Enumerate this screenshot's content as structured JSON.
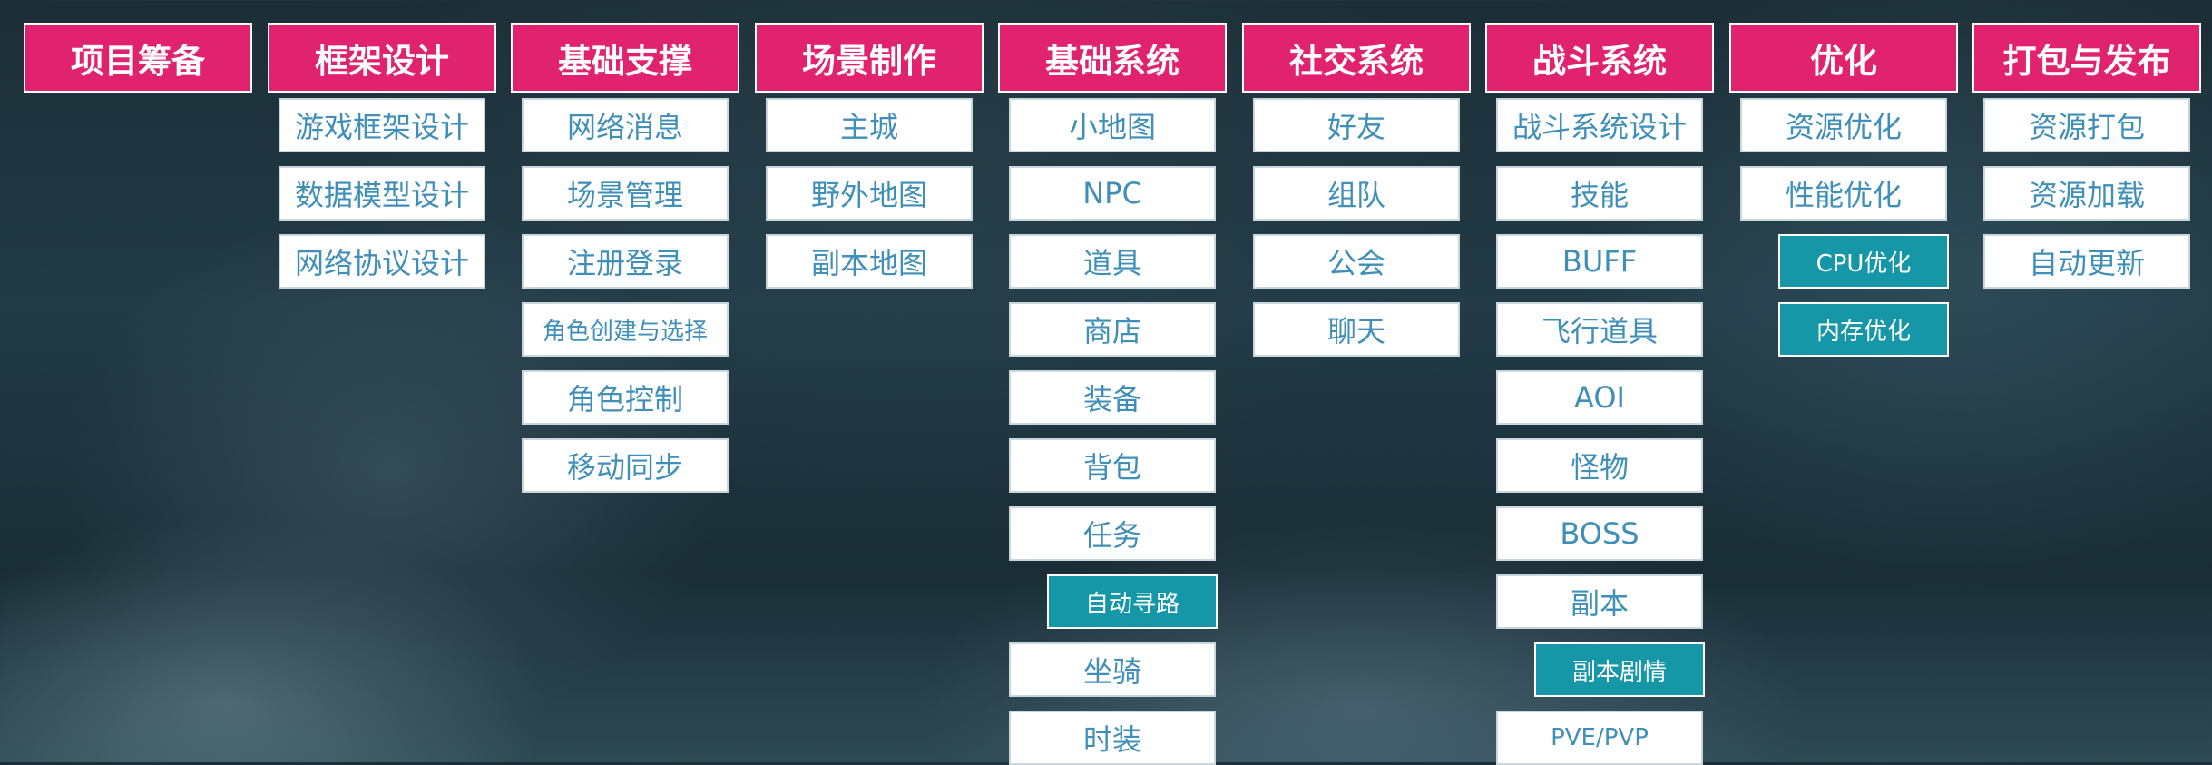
{
  "colors": {
    "header_bg": "#e0226f",
    "item_bg": "#ffffff",
    "item_text": "#3f8fb8",
    "sub_item_bg": "#1597a7"
  },
  "columns": [
    {
      "header": "项目筹备",
      "items": []
    },
    {
      "header": "框架设计",
      "items": [
        {
          "label": "游戏框架设计"
        },
        {
          "label": "数据模型设计"
        },
        {
          "label": "网络协议设计"
        }
      ]
    },
    {
      "header": "基础支撑",
      "items": [
        {
          "label": "网络消息"
        },
        {
          "label": "场景管理"
        },
        {
          "label": "注册登录"
        },
        {
          "label": "角色创建与选择"
        },
        {
          "label": "角色控制"
        },
        {
          "label": "移动同步"
        }
      ]
    },
    {
      "header": "场景制作",
      "items": [
        {
          "label": "主城"
        },
        {
          "label": "野外地图"
        },
        {
          "label": "副本地图"
        }
      ]
    },
    {
      "header": "基础系统",
      "items": [
        {
          "label": "小地图"
        },
        {
          "label": "NPC"
        },
        {
          "label": "道具"
        },
        {
          "label": "商店"
        },
        {
          "label": "装备"
        },
        {
          "label": "背包"
        },
        {
          "label": "任务"
        },
        {
          "label": "自动寻路",
          "sub": true
        },
        {
          "label": "坐骑"
        },
        {
          "label": "时装"
        }
      ]
    },
    {
      "header": "社交系统",
      "items": [
        {
          "label": "好友"
        },
        {
          "label": "组队"
        },
        {
          "label": "公会"
        },
        {
          "label": "聊天"
        }
      ]
    },
    {
      "header": "战斗系统",
      "items": [
        {
          "label": "战斗系统设计"
        },
        {
          "label": "技能"
        },
        {
          "label": "BUFF"
        },
        {
          "label": "飞行道具"
        },
        {
          "label": "AOI"
        },
        {
          "label": "怪物"
        },
        {
          "label": "BOSS"
        },
        {
          "label": "副本"
        },
        {
          "label": "副本剧情",
          "sub": true
        },
        {
          "label": "PVE/PVP"
        }
      ]
    },
    {
      "header": "优化",
      "items": [
        {
          "label": "资源优化"
        },
        {
          "label": "性能优化"
        },
        {
          "label": "CPU优化",
          "sub": true
        },
        {
          "label": "内存优化",
          "sub": true
        }
      ]
    },
    {
      "header": "打包与发布",
      "items": [
        {
          "label": "资源打包"
        },
        {
          "label": "资源加载"
        },
        {
          "label": "自动更新"
        }
      ]
    }
  ]
}
